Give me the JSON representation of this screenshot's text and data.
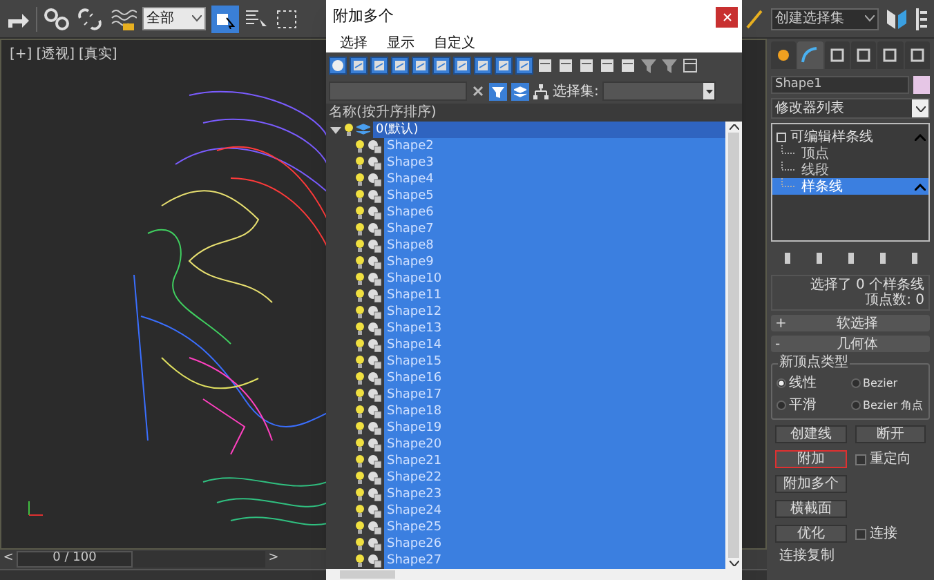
{
  "main_toolbar": {
    "selection_filter": "全部",
    "named_selection_set": "创建选择集"
  },
  "viewport": {
    "labels": [
      "[+]",
      "[透视]",
      "[真实]"
    ],
    "time_slider": {
      "prev": "<",
      "frame": "0 / 100",
      "next": ">",
      "level": 0
    }
  },
  "dialog": {
    "title": "附加多个",
    "menu": [
      "选择",
      "显示",
      "自定义"
    ],
    "selection_set_label": "选择集:",
    "column_header": "名称(按升序排序)",
    "tree": [
      {
        "label": "0(默认)",
        "expanded": true,
        "selected": true,
        "children": [
          {
            "label": "Shape2",
            "selected": true
          },
          {
            "label": "Shape3",
            "selected": true
          },
          {
            "label": "Shape4",
            "selected": true
          },
          {
            "label": "Shape5",
            "selected": true
          },
          {
            "label": "Shape6",
            "selected": true
          },
          {
            "label": "Shape7",
            "selected": true
          },
          {
            "label": "Shape8",
            "selected": true
          },
          {
            "label": "Shape9",
            "selected": true
          },
          {
            "label": "Shape10",
            "selected": true
          },
          {
            "label": "Shape11",
            "selected": true
          },
          {
            "label": "Shape12",
            "selected": true
          },
          {
            "label": "Shape13",
            "selected": true
          },
          {
            "label": "Shape14",
            "selected": true
          },
          {
            "label": "Shape15",
            "selected": true
          },
          {
            "label": "Shape16",
            "selected": true
          },
          {
            "label": "Shape17",
            "selected": true
          },
          {
            "label": "Shape18",
            "selected": true
          },
          {
            "label": "Shape19",
            "selected": true
          },
          {
            "label": "Shape20",
            "selected": true
          },
          {
            "label": "Shape21",
            "selected": true
          },
          {
            "label": "Shape22",
            "selected": true
          },
          {
            "label": "Shape23",
            "selected": true
          },
          {
            "label": "Shape24",
            "selected": true
          },
          {
            "label": "Shape25",
            "selected": true
          },
          {
            "label": "Shape26",
            "selected": true
          },
          {
            "label": "Shape27",
            "selected": true
          }
        ]
      }
    ]
  },
  "command_panel": {
    "panel_tabs": [
      {
        "selected": false
      },
      {
        "selected": true
      },
      {
        "selected": false
      },
      {
        "selected": false
      },
      {
        "selected": false
      },
      {
        "selected": false
      }
    ],
    "object_name": "Shape1",
    "modifier_list": "修改器列表",
    "stack": [
      {
        "label": "可编辑样条线",
        "expanded": true,
        "selected": false,
        "children": [
          {
            "label": "顶点",
            "selected": false
          },
          {
            "label": "线段",
            "selected": false
          },
          {
            "label": "样条线",
            "selected": true
          }
        ]
      }
    ],
    "selection_info": [
      "选择了 0 个样条线",
      "顶点数: 0"
    ],
    "rollouts": [
      {
        "sign": "+",
        "title": "软选择"
      },
      {
        "sign": "-",
        "title": "几何体"
      }
    ],
    "new_vertex_type": {
      "title": "新顶点类型",
      "options": [
        {
          "label": "线性",
          "selected": true
        },
        {
          "label": "Bezier",
          "selected": false
        },
        {
          "label": "平滑",
          "selected": false
        },
        {
          "label": "Bezier 角点",
          "selected": false
        }
      ]
    },
    "geometry_rows": [
      [
        {
          "kind": "button",
          "label": "创建线",
          "highlighted": false
        },
        {
          "kind": "button",
          "label": "断开",
          "highlighted": false
        }
      ],
      [
        {
          "kind": "button",
          "label": "附加",
          "highlighted": true
        },
        {
          "kind": "checkbox",
          "label": "重定向",
          "checked": false
        }
      ],
      [
        {
          "kind": "button",
          "label": "附加多个",
          "highlighted": false
        }
      ],
      [
        {
          "kind": "button",
          "label": "横截面",
          "highlighted": false
        }
      ],
      [
        {
          "kind": "button",
          "label": "优化",
          "highlighted": false
        },
        {
          "kind": "checkbox",
          "label": "连接",
          "checked": false
        }
      ]
    ],
    "footer_label": "连接复制"
  }
}
